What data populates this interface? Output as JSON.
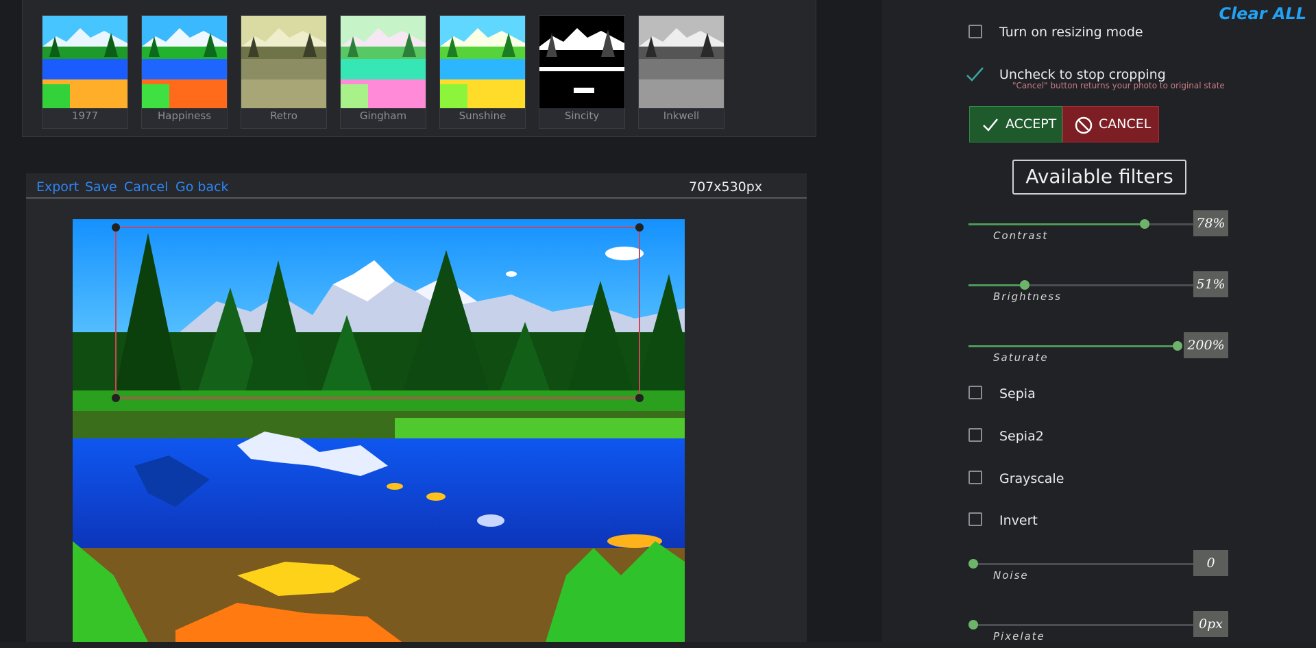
{
  "filters": [
    {
      "label": "1977"
    },
    {
      "label": "Happiness"
    },
    {
      "label": "Retro"
    },
    {
      "label": "Gingham"
    },
    {
      "label": "Sunshine"
    },
    {
      "label": "Sincity"
    },
    {
      "label": "Inkwell"
    }
  ],
  "toolbar": {
    "export_label": "Export",
    "save_label": "Save",
    "cancel_label": "Cancel",
    "go_back_label": "Go back",
    "dimensions": "707x530px"
  },
  "panel": {
    "clear_all": "Clear ALL",
    "resize_label": "Turn on resizing mode",
    "resize_checked": false,
    "crop_label": "Uncheck to stop cropping",
    "crop_checked": true,
    "crop_note": "\"Cancel\" button returns your photo to original state",
    "accept_label": "ACCEPT",
    "cancel_label": "CANCEL",
    "available_filters_label": "Available filters"
  },
  "sliders": [
    {
      "label": "Contrast",
      "value_text": "78%",
      "fraction": 0.78
    },
    {
      "label": "Brightness",
      "value_text": "51%",
      "fraction": 0.25
    },
    {
      "label": "Saturate",
      "value_text": "200%",
      "fraction": 1.0
    },
    {
      "label": "Noise",
      "value_text": "0",
      "fraction": 0.0
    },
    {
      "label": "Pixelate",
      "value_text": "0px",
      "fraction": 0.0
    }
  ],
  "checkboxes": [
    {
      "label": "Sepia",
      "checked": false
    },
    {
      "label": "Sepia2",
      "checked": false
    },
    {
      "label": "Grayscale",
      "checked": false
    },
    {
      "label": "Invert",
      "checked": false
    }
  ],
  "colors": {
    "accent_link": "#2f86f6",
    "clear_all": "#23a1f2",
    "accept_bg": "#1f5a2c",
    "cancel_bg": "#7d1e24",
    "crop_border": "#d0445a",
    "slider_fill": "#4d9a5a"
  }
}
